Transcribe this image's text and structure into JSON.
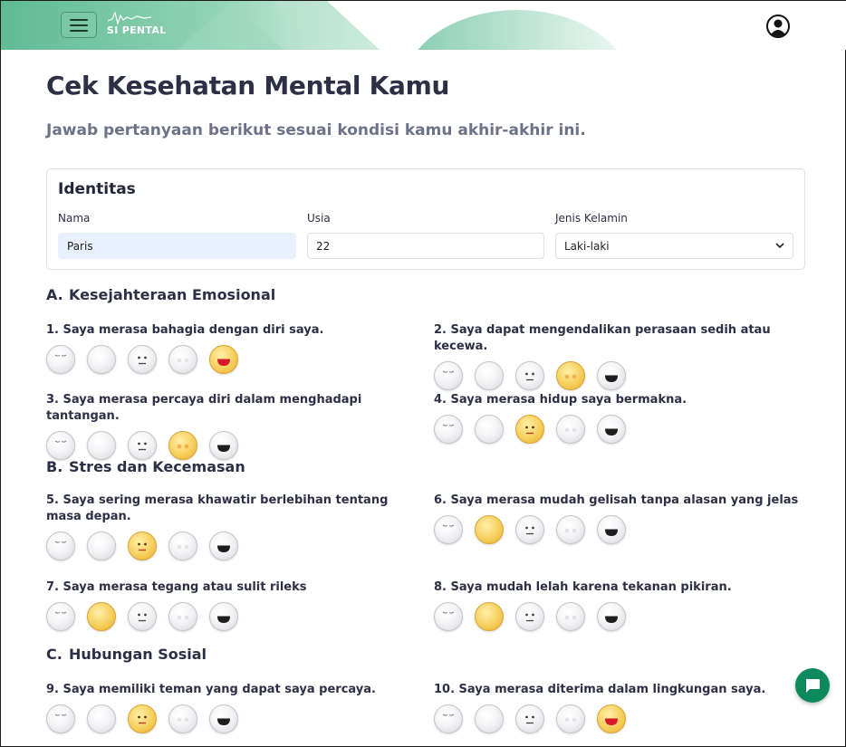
{
  "header": {
    "brand": "SI PENTAL"
  },
  "page": {
    "title": "Cek Kesehatan Mental Kamu",
    "subtitle": "Jawab pertanyaan berikut sesuai kondisi kamu akhir-akhir ini."
  },
  "identity": {
    "title": "Identitas",
    "name_label": "Nama",
    "name_value": "Paris",
    "age_label": "Usia",
    "age_value": "22",
    "gender_label": "Jenis Kelamin",
    "gender_value": "Laki-laki"
  },
  "sections": [
    {
      "letter": "A.",
      "title": "Kesejahteraan Emosional"
    },
    {
      "letter": "B.",
      "title": "Stres dan Kecemasan"
    },
    {
      "letter": "C.",
      "title": "Hubungan Sosial"
    }
  ],
  "questions": [
    {
      "text": "1. Saya merasa bahagia dengan diri saya.",
      "selected": 5
    },
    {
      "text": "2. Saya dapat mengendalikan perasaan sedih atau kecewa.",
      "selected": 4
    },
    {
      "text": "3. Saya merasa percaya diri dalam menghadapi tantangan.",
      "selected": 4
    },
    {
      "text": "4. Saya merasa hidup saya bermakna.",
      "selected": 3
    },
    {
      "text": "5. Saya sering merasa khawatir berlebihan tentang masa depan.",
      "selected": 3
    },
    {
      "text": "6. Saya merasa mudah gelisah tanpa alasan yang jelas",
      "selected": 2
    },
    {
      "text": "7. Saya merasa tegang atau sulit rileks",
      "selected": 2
    },
    {
      "text": "8. Saya mudah lelah karena tekanan pikiran.",
      "selected": 2
    },
    {
      "text": "9. Saya memiliki teman yang dapat saya percaya.",
      "selected": 3
    },
    {
      "text": "10. Saya merasa diterima dalam lingkungan saya.",
      "selected": 5
    }
  ],
  "icons": {
    "menu": "hamburger-icon",
    "account": "user-circle-icon",
    "chat": "chat-bubble-icon",
    "select": "chevron-down-icon",
    "faces": [
      "sleepy-face-icon",
      "blank-face-icon",
      "neutral-face-icon",
      "blush-face-icon",
      "happy-face-icon"
    ]
  },
  "colors": {
    "primary_green": "#0c8a5e",
    "selected_face": "#f6cf5d",
    "text_dark": "#2d2f45",
    "text_muted": "#6c7288"
  }
}
